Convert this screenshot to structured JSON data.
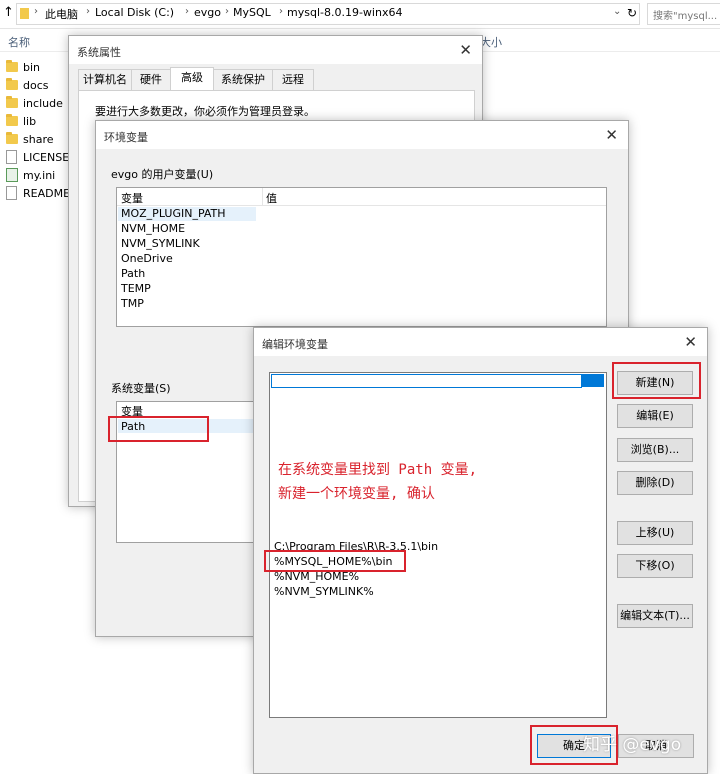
{
  "explorer": {
    "back_arrow": "↑",
    "breadcrumbs": [
      "此电脑",
      "Local Disk (C:)",
      "evgo",
      "MySQL",
      "mysql-8.0.19-winx64"
    ],
    "refresh": "↻",
    "search_placeholder": "搜索\"mysql...",
    "columns": {
      "name": "名称",
      "size": "大小"
    },
    "files": [
      {
        "name": "bin",
        "type": "folder"
      },
      {
        "name": "docs",
        "type": "folder"
      },
      {
        "name": "include",
        "type": "folder"
      },
      {
        "name": "lib",
        "type": "folder"
      },
      {
        "name": "share",
        "type": "folder"
      },
      {
        "name": "LICENSE",
        "type": "file"
      },
      {
        "name": "my.ini",
        "type": "ini"
      },
      {
        "name": "README",
        "type": "file"
      }
    ]
  },
  "system_properties": {
    "title": "系统属性",
    "tabs": [
      "计算机名",
      "硬件",
      "高级",
      "系统保护",
      "远程"
    ],
    "active_tab": "高级",
    "notice": "要进行大多数更改，你必须作为管理员登录。"
  },
  "env_vars": {
    "title": "环境变量",
    "user_group": "evgo 的用户变量(U)",
    "columns": {
      "variable": "变量",
      "value": "值"
    },
    "user_vars": [
      "MOZ_PLUGIN_PATH",
      "NVM_HOME",
      "NVM_SYMLINK",
      "OneDrive",
      "Path",
      "TEMP",
      "TMP"
    ],
    "system_group": "系统变量(S)",
    "system_column": "变量",
    "system_selected": "Path"
  },
  "edit_env": {
    "title": "编辑环境变量",
    "entries": [
      "C:\\Program Files\\R\\R-3.5.1\\bin",
      "%MYSQL_HOME%\\bin",
      "%NVM_HOME%",
      "%NVM_SYMLINK%"
    ],
    "buttons": {
      "new": "新建(N)",
      "edit": "编辑(E)",
      "browse": "浏览(B)...",
      "delete": "删除(D)",
      "move_up": "上移(U)",
      "move_down": "下移(O)",
      "edit_text": "编辑文本(T)..."
    },
    "ok": "确定",
    "cancel": "取消"
  },
  "annotation": {
    "line1": "在系统变量里找到 Path 变量,",
    "line2": "新建一个环境变量, 确认"
  },
  "watermark": "知乎 @evgo",
  "colors": {
    "highlight": "#d9232d",
    "accent": "#0078d7"
  }
}
